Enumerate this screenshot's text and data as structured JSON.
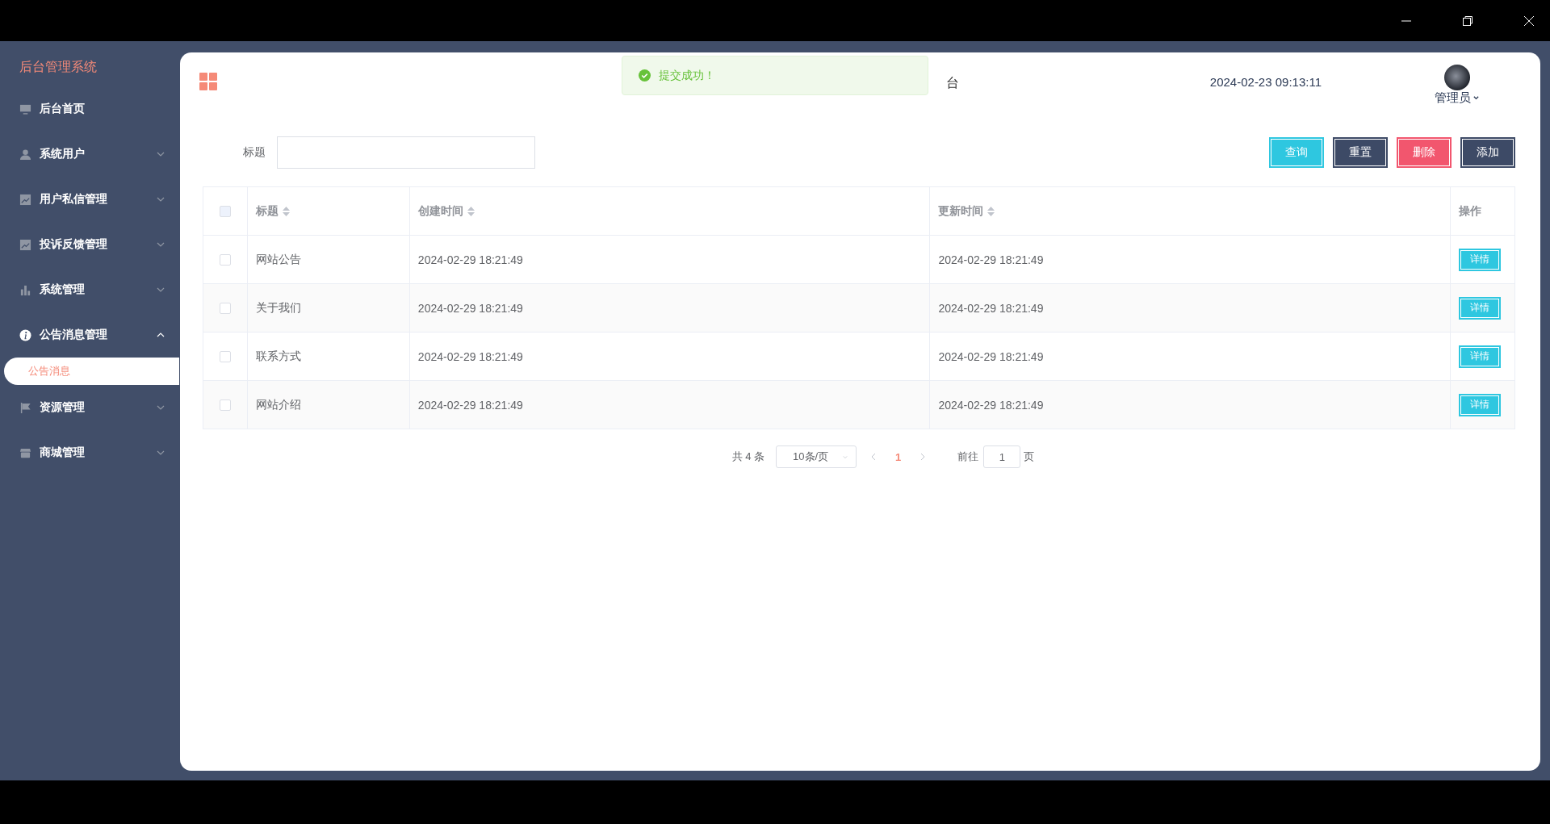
{
  "sidebar": {
    "title": "后台管理系统",
    "items": [
      {
        "label": "后台首页"
      },
      {
        "label": "系统用户",
        "expanded": false
      },
      {
        "label": "用户私信管理",
        "expanded": false
      },
      {
        "label": "投诉反馈管理",
        "expanded": false
      },
      {
        "label": "系统管理",
        "expanded": false
      },
      {
        "label": "公告消息管理",
        "expanded": true,
        "children": [
          {
            "label": "公告消息",
            "selected": true
          }
        ]
      },
      {
        "label": "资源管理",
        "expanded": false
      },
      {
        "label": "商城管理",
        "expanded": false
      }
    ]
  },
  "header": {
    "title_fragment": "台",
    "datetime": "2024-02-23 09:13:11",
    "user": "管理员"
  },
  "toast": {
    "kind": "success",
    "message": "提交成功！"
  },
  "search": {
    "label": "标题"
  },
  "buttons": [
    {
      "label": "查询",
      "kind": "query"
    },
    {
      "label": "重置",
      "kind": "reset"
    },
    {
      "label": "删除",
      "kind": "delete"
    },
    {
      "label": "添加",
      "kind": "add"
    }
  ],
  "table": {
    "all_checked": false,
    "columns": [
      {
        "label": "标题",
        "sortable": true
      },
      {
        "label": "创建时间",
        "sortable": true
      },
      {
        "label": "更新时间",
        "sortable": true
      },
      {
        "label": "操作",
        "sortable": false
      }
    ],
    "rows": [
      {
        "checked": false,
        "title": "网站公告",
        "created": "2024-02-29 18:21:49",
        "updated": "2024-02-29 18:21:49",
        "action": "详情"
      },
      {
        "checked": false,
        "title": "关于我们",
        "created": "2024-02-29 18:21:49",
        "updated": "2024-02-29 18:21:49",
        "action": "详情"
      },
      {
        "checked": false,
        "title": "联系方式",
        "created": "2024-02-29 18:21:49",
        "updated": "2024-02-29 18:21:49",
        "action": "详情"
      },
      {
        "checked": false,
        "title": "网站介绍",
        "created": "2024-02-29 18:21:49",
        "updated": "2024-02-29 18:21:49",
        "action": "详情"
      }
    ]
  },
  "pagination": {
    "total": "共 4 条",
    "page_size": "10条/页",
    "pages": [
      {
        "label": "1",
        "selected": true
      }
    ],
    "goto_label": "前往",
    "goto_value": "1",
    "goto_suffix": "页"
  }
}
